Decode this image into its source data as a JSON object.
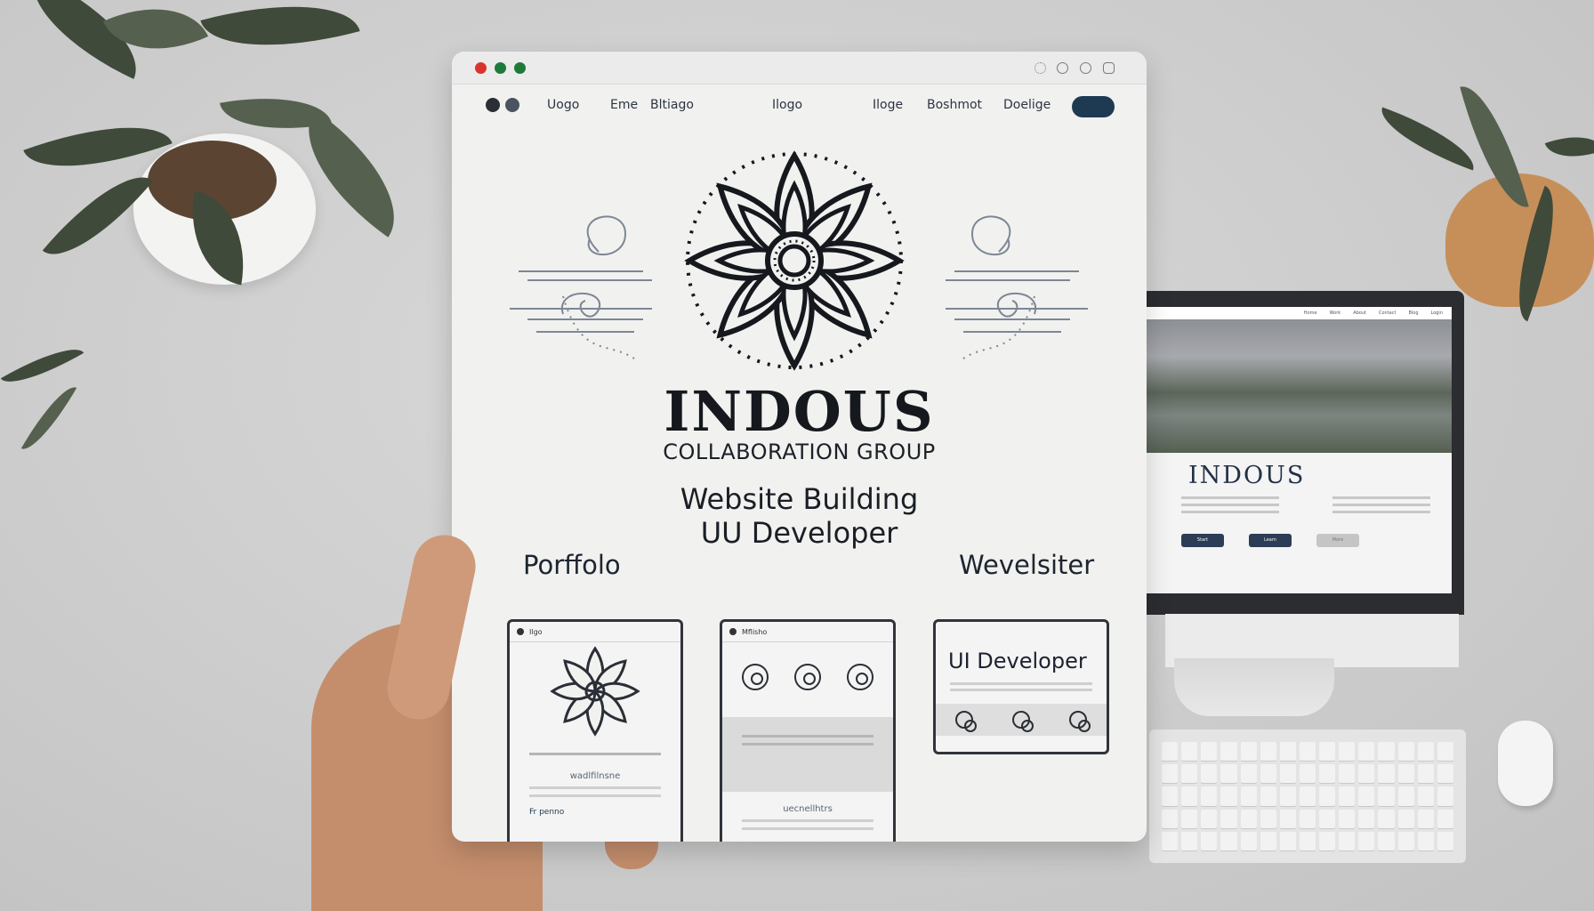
{
  "browser": {
    "traffic_lights": {
      "close": "#d8342c",
      "minimize": "#1f7a3a",
      "zoom": "#1f7a3a"
    },
    "toolbar_icons": [
      "extension-icon",
      "history-icon",
      "profile-icon",
      "settings-icon"
    ]
  },
  "site_nav": {
    "links": [
      "Uogo",
      "Eme",
      "Bltiago",
      "Ilogo",
      "Iloge",
      "Boshmot",
      "Doelige"
    ],
    "cta_color": "#1d3a52"
  },
  "hero": {
    "brand_title": "INDOUS",
    "brand_subtitle": "COLLABORATION GROUP",
    "tagline_1": "Website Building",
    "tagline_2": "UU Developer"
  },
  "sections": {
    "left_label": "Porffolo",
    "right_label": "Wevelsiter"
  },
  "thumbnails": {
    "first": {
      "bar_label": "Ilgo",
      "caption": "wadlfilnsne",
      "footer": "Fr penno"
    },
    "second": {
      "bar_label": "Mflisho",
      "caption": "uecnellhtrs"
    },
    "third": {
      "heading": "UI Developer"
    }
  },
  "background_monitor": {
    "brand": "INDOUS",
    "nav": [
      "Home",
      "Work",
      "About",
      "Contact",
      "Blog",
      "Login"
    ],
    "buttons": [
      "Start",
      "Learn",
      "More"
    ]
  }
}
